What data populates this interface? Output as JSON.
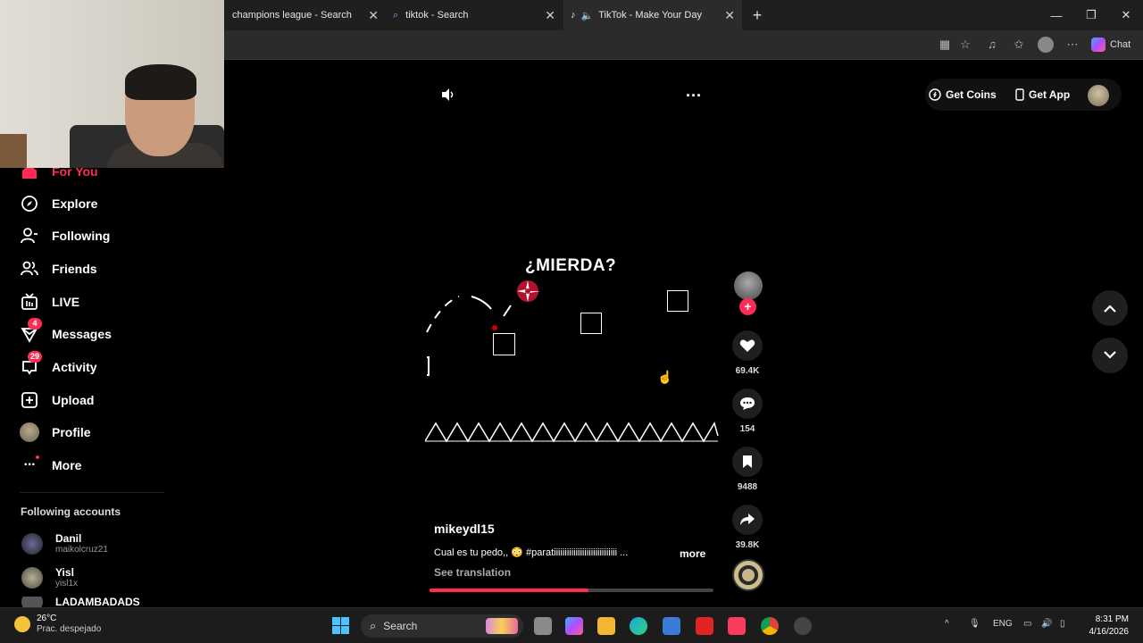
{
  "browser": {
    "tabs": [
      {
        "title": "champions league - Search"
      },
      {
        "title": "tiktok - Search"
      },
      {
        "title": "TikTok - Make Your Day"
      }
    ],
    "chat_label": "Chat"
  },
  "sidebar": {
    "items": [
      {
        "label": "For You",
        "icon": "home-icon"
      },
      {
        "label": "Explore",
        "icon": "compass-icon"
      },
      {
        "label": "Following",
        "icon": "user-follow-icon"
      },
      {
        "label": "Friends",
        "icon": "friends-icon"
      },
      {
        "label": "LIVE",
        "icon": "live-tv-icon"
      },
      {
        "label": "Messages",
        "icon": "send-icon",
        "badge": "4"
      },
      {
        "label": "Activity",
        "icon": "inbox-icon",
        "badge": "29"
      },
      {
        "label": "Upload",
        "icon": "plus-square-icon"
      },
      {
        "label": "Profile",
        "icon": "avatar"
      },
      {
        "label": "More",
        "icon": "ellipsis-icon"
      }
    ],
    "following_title": "Following accounts",
    "accounts": [
      {
        "name": "Danil",
        "username": "maikolcruz21"
      },
      {
        "name": "Yisl",
        "username": "yisl1x"
      },
      {
        "name": "LADAMBADADS",
        "username": ""
      }
    ]
  },
  "header": {
    "get_coins": "Get Coins",
    "get_app": "Get App"
  },
  "video": {
    "caption_overlay": "¿MIERDA?",
    "author": "mikeydl15",
    "description": "Cual es tu pedo,, 😳 #paratiiiiiiiiiiiiiiiiiiiiiiiiiiiii ...",
    "more": "more",
    "see_translation": "See translation",
    "progress": 0.56
  },
  "actions": {
    "likes": "69.4K",
    "comments": "154",
    "saves": "9488",
    "shares": "39.8K"
  },
  "taskbar": {
    "temperature": "26°C",
    "weather": "Prac. despejado",
    "search": "Search",
    "lang": "ENG",
    "time": "8:31 PM",
    "date": "4/16/2026"
  },
  "colors": {
    "accent": "#fe2c55",
    "background": "#000000"
  }
}
